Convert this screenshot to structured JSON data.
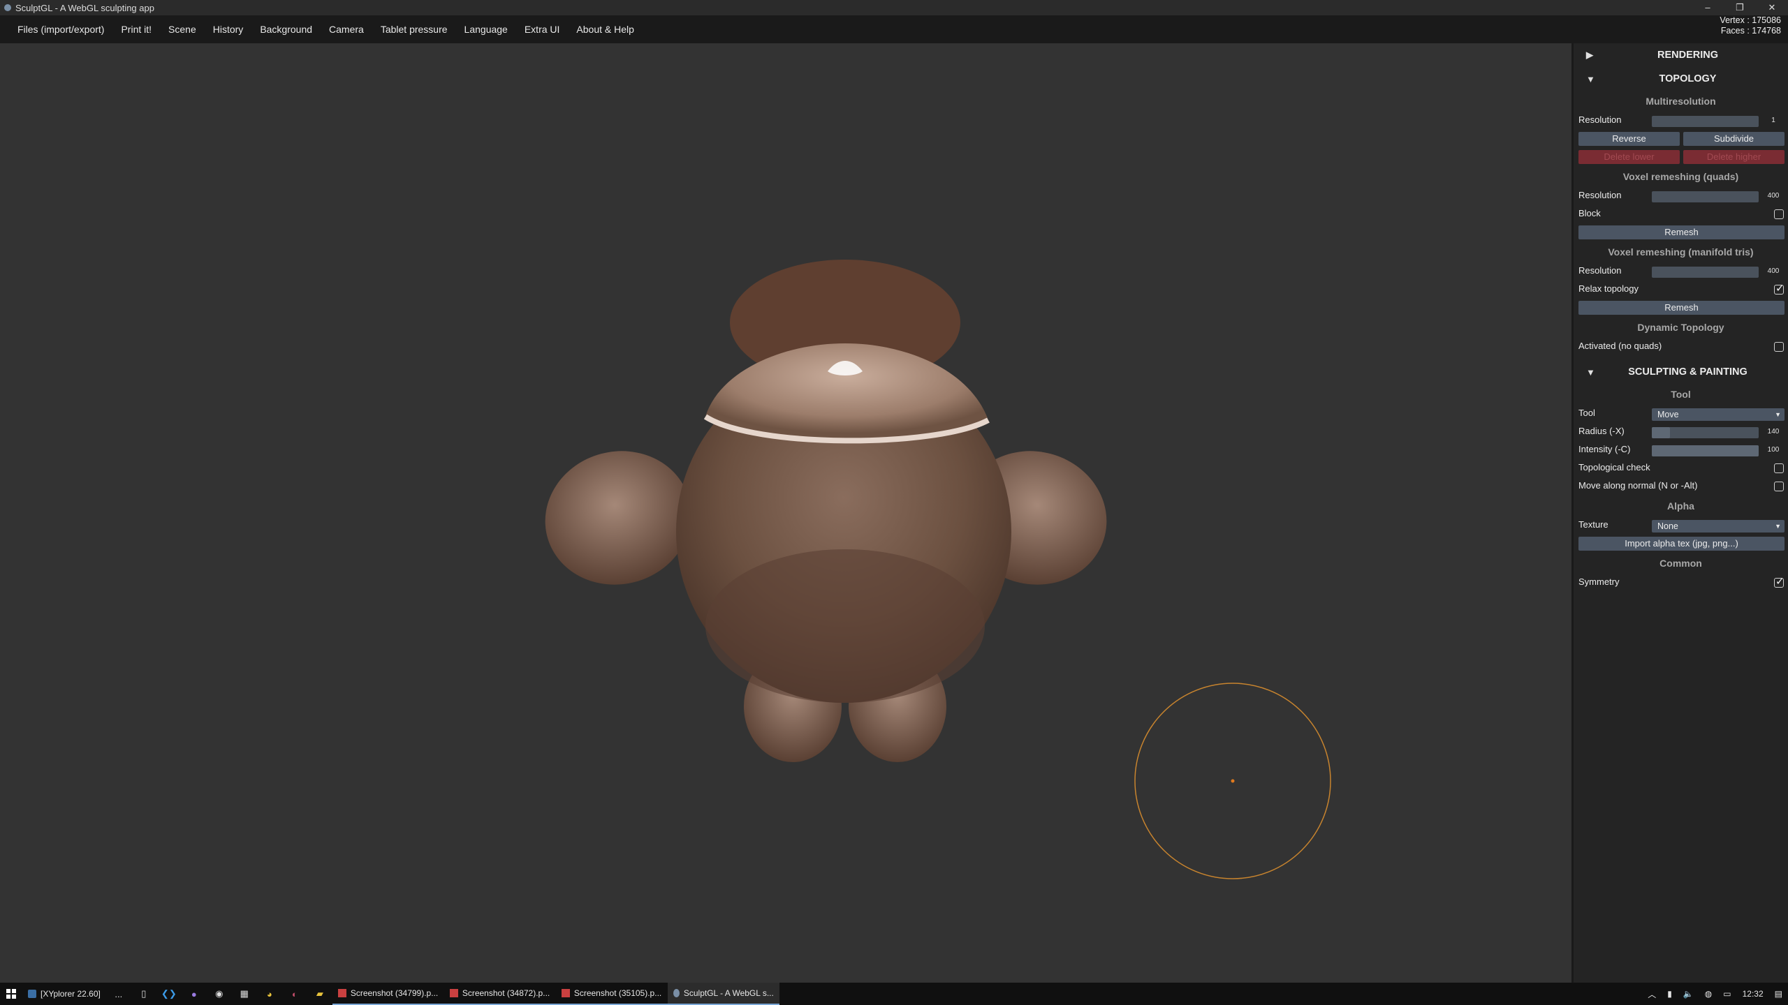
{
  "window": {
    "title": "SculptGL - A WebGL sculpting app",
    "controls": {
      "minimize": "–",
      "maximize": "❐",
      "close": "✕"
    }
  },
  "menu": [
    "Files (import/export)",
    "Print it!",
    "Scene",
    "History",
    "Background",
    "Camera",
    "Tablet pressure",
    "Language",
    "Extra UI",
    "About & Help"
  ],
  "stats": {
    "vertex": "Vertex : 175086",
    "faces": "Faces : 174768"
  },
  "panel": {
    "rendering": {
      "title": "RENDERING",
      "arrow": "▶"
    },
    "topology": {
      "title": "TOPOLOGY",
      "arrow": "▼",
      "multires": {
        "title": "Multiresolution",
        "resolution_label": "Resolution",
        "resolution_value": "1",
        "reverse": "Reverse",
        "subdivide": "Subdivide",
        "delete_lower": "Delete lower",
        "delete_higher": "Delete higher"
      },
      "voxel_quads": {
        "title": "Voxel remeshing (quads)",
        "resolution_label": "Resolution",
        "resolution_value": "400",
        "block_label": "Block",
        "block_checked": false,
        "remesh": "Remesh"
      },
      "voxel_tris": {
        "title": "Voxel remeshing (manifold tris)",
        "resolution_label": "Resolution",
        "resolution_value": "400",
        "relax_label": "Relax topology",
        "relax_checked": true,
        "remesh": "Remesh"
      },
      "dynamic": {
        "title": "Dynamic Topology",
        "activated_label": "Activated (no quads)",
        "activated_checked": false
      }
    },
    "sculpt": {
      "title": "SCULPTING & PAINTING",
      "arrow": "▼",
      "tool_title": "Tool",
      "tool_label": "Tool",
      "tool_value": "Move",
      "radius_label": "Radius (-X)",
      "radius_value": "140",
      "radius_fraction": 0.17,
      "intensity_label": "Intensity (-C)",
      "intensity_value": "100",
      "intensity_fraction": 1.0,
      "topo_check_label": "Topological check",
      "topo_check_checked": false,
      "move_normal_label": "Move along normal (N or -Alt)",
      "move_normal_checked": false,
      "alpha_title": "Alpha",
      "texture_label": "Texture",
      "texture_value": "None",
      "import_alpha": "Import alpha tex (jpg, png...)",
      "common_title": "Common",
      "symmetry_label": "Symmetry",
      "symmetry_checked": true
    }
  },
  "taskbar": {
    "xyplorer": "[XYplorer 22.60]",
    "overflow": "...",
    "windows": [
      "Screenshot (34799).p...",
      "Screenshot (34872).p...",
      "Screenshot (35105).p...",
      "SculptGL - A WebGL s..."
    ],
    "clock": "12:32"
  },
  "colors": {
    "brush": "#c8842e",
    "accent": "#7aa7d6"
  }
}
